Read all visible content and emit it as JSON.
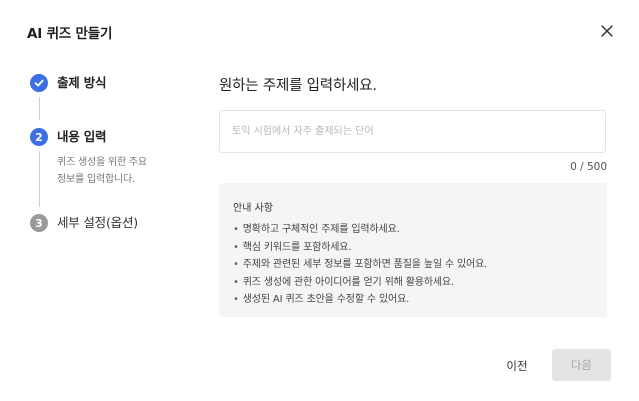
{
  "dialog": {
    "title": "AI 퀴즈 만들기",
    "close_icon": "close-icon"
  },
  "stepper": {
    "steps": [
      {
        "number": "1",
        "label": "출제 방식",
        "state": "done",
        "icon": "check-icon"
      },
      {
        "number": "2",
        "label": "내용 입력",
        "state": "active",
        "description_line1": "퀴즈 생성을 위한 주요",
        "description_line2": "정보를 입력합니다."
      },
      {
        "number": "3",
        "label": "세부 설정(옵션)",
        "state": "pending"
      }
    ]
  },
  "main": {
    "heading": "원하는 주제를 입력하세요.",
    "topic_input": {
      "value": "",
      "placeholder": "토익 시험에서 자주 출제되는 단어"
    },
    "counter": "0 / 500",
    "guide": {
      "title": "안내 사항",
      "items": [
        "명확하고 구체적인 주제를 입력하세요.",
        "핵심 키워드를 포함하세요.",
        "주제와 관련된 세부 정보를 포함하면 품질을 높일 수 있어요.",
        "퀴즈 생성에 관한 아이디어를 얻기 위해 활용하세요.",
        "생성된 AI 퀴즈 초안을 수정할 수 있어요."
      ]
    }
  },
  "footer": {
    "prev_label": "이전",
    "next_label": "다음"
  },
  "colors": {
    "accent": "#3c6fe4",
    "pending": "#9a9a9a",
    "disabled_button": "#e4e4e4"
  }
}
